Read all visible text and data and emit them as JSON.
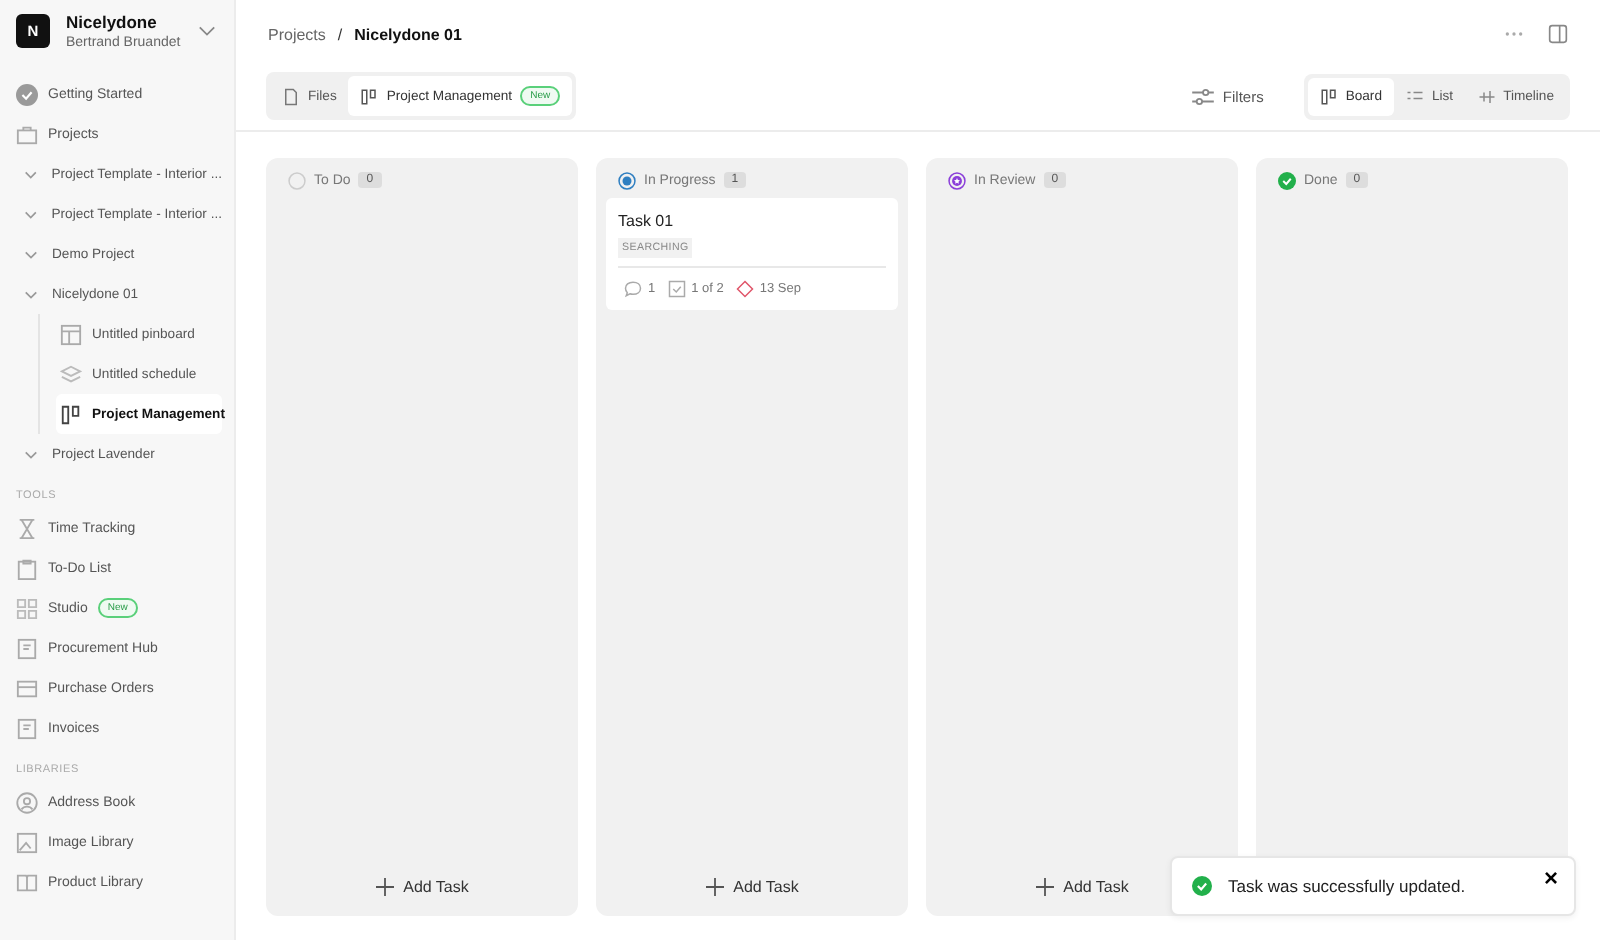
{
  "workspace": {
    "initial": "N",
    "name": "Nicelydone",
    "user": "Bertrand Bruandet"
  },
  "nav": [
    {
      "label": "Getting Started"
    },
    {
      "label": "Projects"
    }
  ],
  "projects": [
    {
      "label": "Project Template - Interior ..."
    },
    {
      "label": "Project Template - Interior ..."
    },
    {
      "label": "Demo Project"
    },
    {
      "label": "Nicelydone 01",
      "children": [
        {
          "label": "Untitled pinboard",
          "selected": false
        },
        {
          "label": "Untitled schedule",
          "selected": false
        },
        {
          "label": "Project Management",
          "selected": true
        }
      ]
    },
    {
      "label": "Project Lavender"
    }
  ],
  "sections": [
    {
      "title": "TOOLS",
      "items": [
        {
          "label": "Time Tracking"
        },
        {
          "label": "To-Do List"
        },
        {
          "label": "Studio",
          "badge": "New"
        },
        {
          "label": "Procurement Hub"
        },
        {
          "label": "Purchase Orders"
        },
        {
          "label": "Invoices"
        }
      ]
    },
    {
      "title": "LIBRARIES",
      "items": [
        {
          "label": "Address Book"
        },
        {
          "label": "Image Library"
        },
        {
          "label": "Product Library"
        }
      ]
    }
  ],
  "breadcrumb": {
    "parent": "Projects",
    "separator": "/",
    "current": "Nicelydone 01"
  },
  "tabs": [
    {
      "label": "Files",
      "selected": false
    },
    {
      "label": "Project Management",
      "selected": true,
      "badge": "New"
    }
  ],
  "filters": "Filters",
  "views": [
    {
      "label": "Board",
      "selected": true
    },
    {
      "label": "List",
      "selected": false
    },
    {
      "label": "Timeline",
      "selected": false
    }
  ],
  "columns": [
    {
      "title": "To Do",
      "count": "0",
      "kind": "todo",
      "color": "#cccccc",
      "add": "Add Task"
    },
    {
      "title": "In Progress",
      "count": "1",
      "kind": "progress",
      "color": "#2f7fc1",
      "add": "Add Task",
      "cards": [
        {
          "title": "Task 01",
          "tag": "SEARCHING",
          "comments": "1",
          "checklist": "1 of 2",
          "due": "13 Sep"
        }
      ]
    },
    {
      "title": "In Review",
      "count": "0",
      "kind": "review",
      "color": "#8b3fd9",
      "add": "Add Task"
    },
    {
      "title": "Done",
      "count": "0",
      "kind": "done",
      "color": "#22b04b"
    }
  ],
  "toast": {
    "message": "Task was successfully updated.",
    "close": "×"
  }
}
